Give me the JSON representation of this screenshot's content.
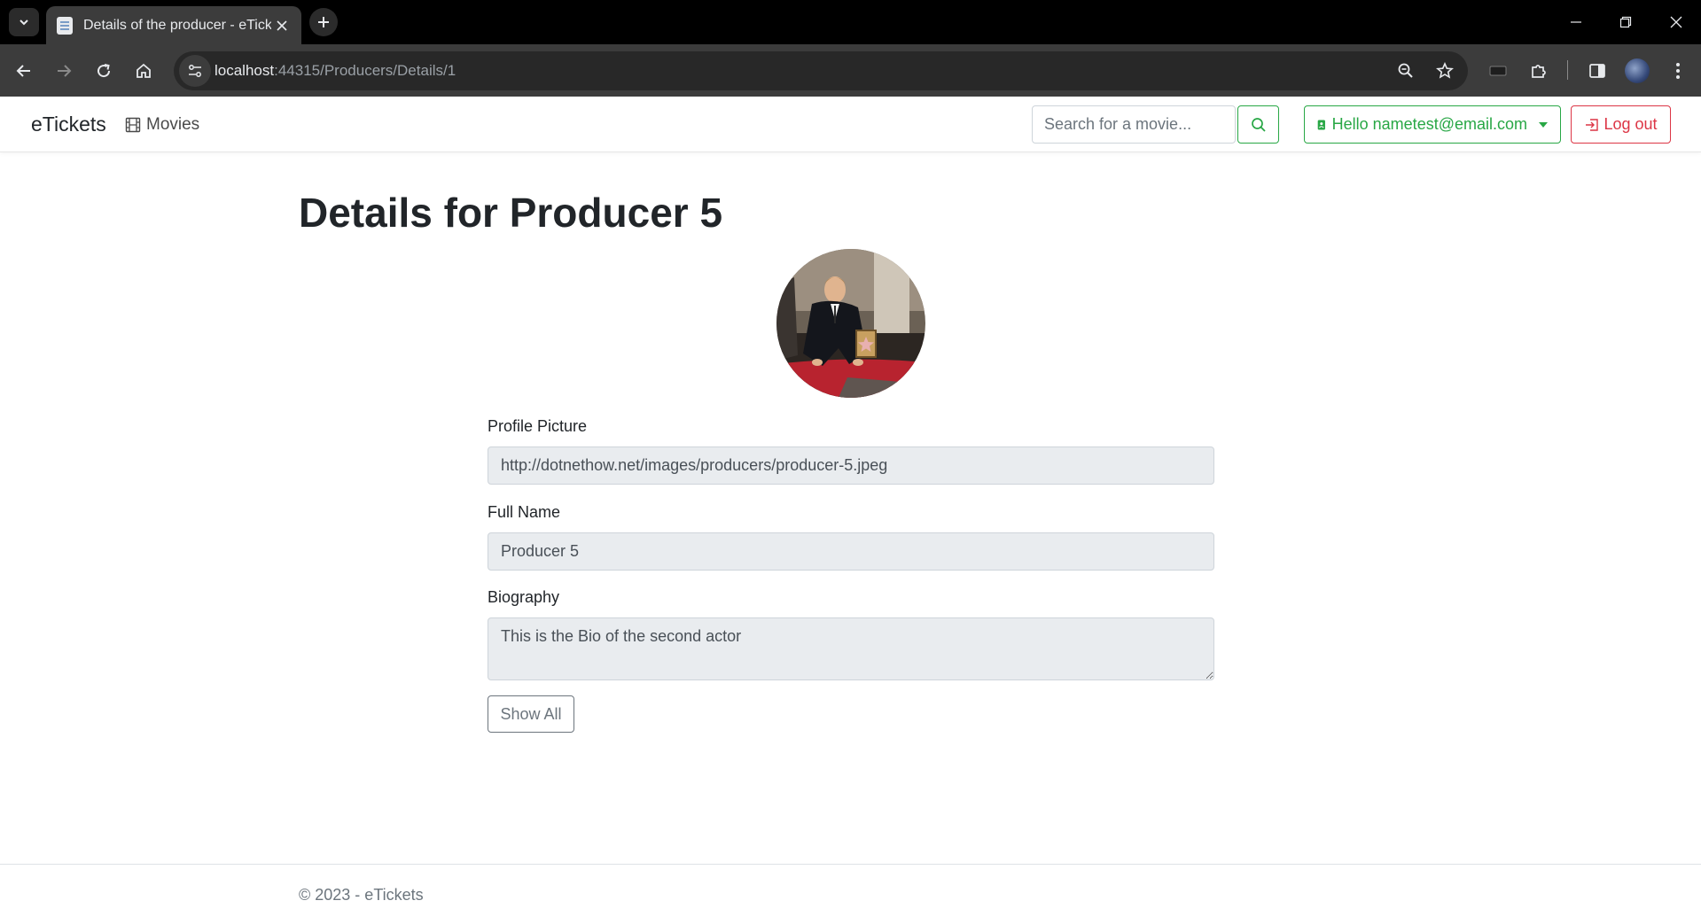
{
  "browser": {
    "tab_title": "Details of the producer - eTickets",
    "url_host": "localhost",
    "url_path": ":44315/Producers/Details/1"
  },
  "navbar": {
    "brand": "eTickets",
    "movies_label": "Movies",
    "search_placeholder": "Search for a movie...",
    "user_label": "Hello nametest@email.com",
    "logout_label": "Log out"
  },
  "page": {
    "title": "Details for Producer 5"
  },
  "form": {
    "profile_picture_label": "Profile Picture",
    "profile_picture_value": "http://dotnethow.net/images/producers/producer-5.jpeg",
    "full_name_label": "Full Name",
    "full_name_value": "Producer 5",
    "biography_label": "Biography",
    "biography_value": "This is the Bio of the second actor",
    "show_all_label": "Show All"
  },
  "footer": {
    "text": "© 2023 - eTickets"
  },
  "colors": {
    "success": "#28a745",
    "danger": "#dc3545",
    "secondary": "#6c757d",
    "readonly_bg": "#e9ecef"
  }
}
